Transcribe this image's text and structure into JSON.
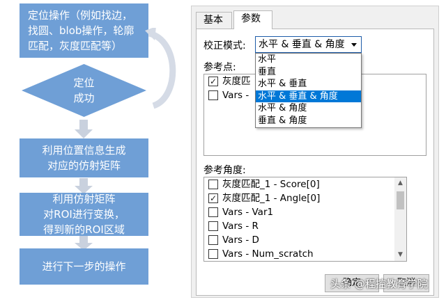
{
  "flowchart": {
    "step1": "定位操作（例如找边，\n找圆、blob操作，轮廓\n匹配，灰度匹配等）",
    "decision": "定位\n成功",
    "step2": "利用位置信息生成\n对应的仿射矩阵",
    "step3": "利用仿射矩阵\n对ROI进行变换，\n得到新的ROI区域",
    "step4": "进行下一步的操作"
  },
  "colors": {
    "flow_box": "#6f9fd6",
    "arrow": "#c9d1de",
    "selection": "#0078d7"
  },
  "dialog": {
    "tabs": [
      {
        "label": "基本",
        "active": false
      },
      {
        "label": "参数",
        "active": true
      }
    ],
    "correction_mode": {
      "label": "校正模式:",
      "selected": "水平 & 垂直 & 角度",
      "options": [
        "水平",
        "垂直",
        "水平 & 垂直",
        "水平 & 垂直 & 角度",
        "水平 & 角度",
        "垂直 & 角度"
      ],
      "selected_index": 3
    },
    "ref_points": {
      "label": "参考点:",
      "items": [
        {
          "label": "灰度匹",
          "checked": true
        },
        {
          "label": "Vars -",
          "checked": false
        }
      ]
    },
    "ref_angle": {
      "label": "参考角度:",
      "items": [
        {
          "label": "灰度匹配_1 - Score[0]",
          "checked": false
        },
        {
          "label": "灰度匹配_1 - Angle[0]",
          "checked": true
        },
        {
          "label": "Vars - Var1",
          "checked": false
        },
        {
          "label": "Vars - R",
          "checked": false
        },
        {
          "label": "Vars - D",
          "checked": false
        },
        {
          "label": "Vars - Num_scratch",
          "checked": false
        }
      ]
    },
    "buttons": {
      "ok": "确定",
      "cancel": "取消"
    }
  },
  "watermark": "头条 @程控教育学院"
}
